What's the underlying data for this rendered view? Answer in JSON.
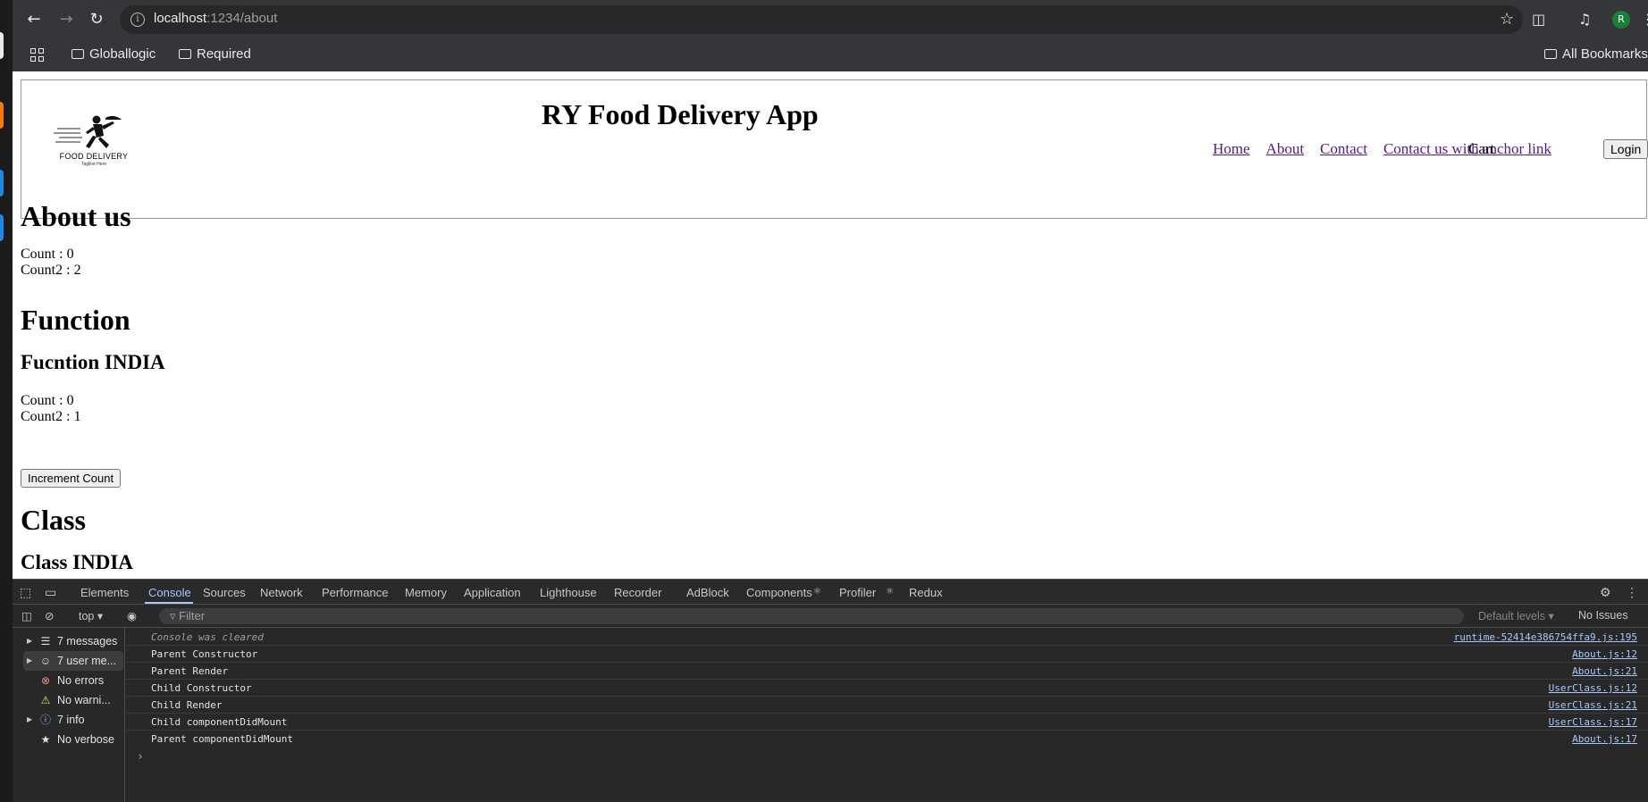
{
  "browser": {
    "url_host": "localhost",
    "url_path": ":1234/about",
    "bookmarks": [
      "Globallogic",
      "Required"
    ],
    "all_bookmarks": "All Bookmarks",
    "avatar_letter": "R"
  },
  "page": {
    "app_title": "RY Food Delivery App",
    "logo_text": "FOOD  DELIVERY",
    "logo_tagline": "Tagline Here",
    "nav": [
      "Home",
      "About",
      "Contact",
      "Contact us with anchor link"
    ],
    "cart": "Cart",
    "login": "Login",
    "about_heading": "About us",
    "about_count": "Count : 0",
    "about_count2": "Count2 : 2",
    "function_heading": "Function",
    "function_sub": "Fucntion INDIA",
    "function_count": "Count : 0",
    "function_count2": "Count2 : 1",
    "increment_button": "Increment Count",
    "class_heading": "Class",
    "class_sub": "Class INDIA"
  },
  "devtools": {
    "tabs": [
      "Elements",
      "Console",
      "Sources",
      "Network",
      "Performance",
      "Memory",
      "Application",
      "Lighthouse",
      "Recorder",
      "AdBlock",
      "Components",
      "Profiler",
      "Redux"
    ],
    "context": "top",
    "filter_placeholder": "Filter",
    "levels": "Default levels",
    "issues": "No Issues",
    "sidebar": [
      "7 messages",
      "7 user me...",
      "No errors",
      "No warni...",
      "7 info",
      "No verbose"
    ],
    "console_rows": [
      {
        "msg": "Console was cleared",
        "src": "runtime-52414e386754ffa9.js:195"
      },
      {
        "msg": "Parent Constructor",
        "src": "About.js:12"
      },
      {
        "msg": "Parent Render",
        "src": "About.js:21"
      },
      {
        "msg": "Child Constructor",
        "src": "UserClass.js:12"
      },
      {
        "msg": "Child Render",
        "src": "UserClass.js:21"
      },
      {
        "msg": "Child componentDidMount",
        "src": "UserClass.js:17"
      },
      {
        "msg": "Parent componentDidMount",
        "src": "About.js:17"
      }
    ],
    "prompt": "›"
  },
  "colors": {
    "link_visited": "#551a8b",
    "devtools_accent": "#a8c7fa",
    "error_red": "#f28b82",
    "warning_orange": "#fdd663"
  }
}
